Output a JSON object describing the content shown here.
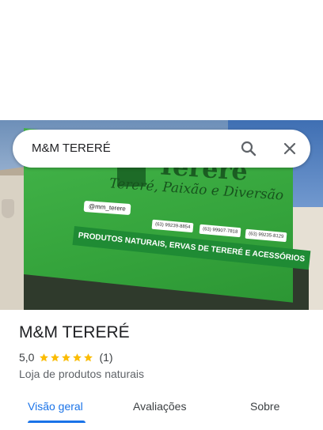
{
  "search": {
    "query": "M&M TERERÉ"
  },
  "photo": {
    "sign_title": "Tereré",
    "sign_tagline": "Tereré, Paixão e Diversão",
    "sign_instagram": "@mm_terere",
    "sign_phones": [
      "(63) 99239-8854",
      "(63) 99907-7818",
      "(63) 99235-8129"
    ],
    "sign_products": "PRODUTOS NATURAIS, ERVAS DE TERERÉ E ACESSÓRIOS"
  },
  "place": {
    "name": "M&M TERERÉ",
    "rating": "5,0",
    "stars": 5,
    "review_count": "(1)",
    "category": "Loja de produtos naturais"
  },
  "tabs": [
    {
      "label": "Visão geral",
      "active": true
    },
    {
      "label": "Avaliações",
      "active": false
    },
    {
      "label": "Sobre",
      "active": false
    }
  ],
  "colors": {
    "accent": "#1a73e8",
    "star": "#fbbc04",
    "sign_green": "#3aaa40"
  },
  "icons": {
    "search": "search-icon",
    "close": "close-icon",
    "star": "star-icon"
  }
}
